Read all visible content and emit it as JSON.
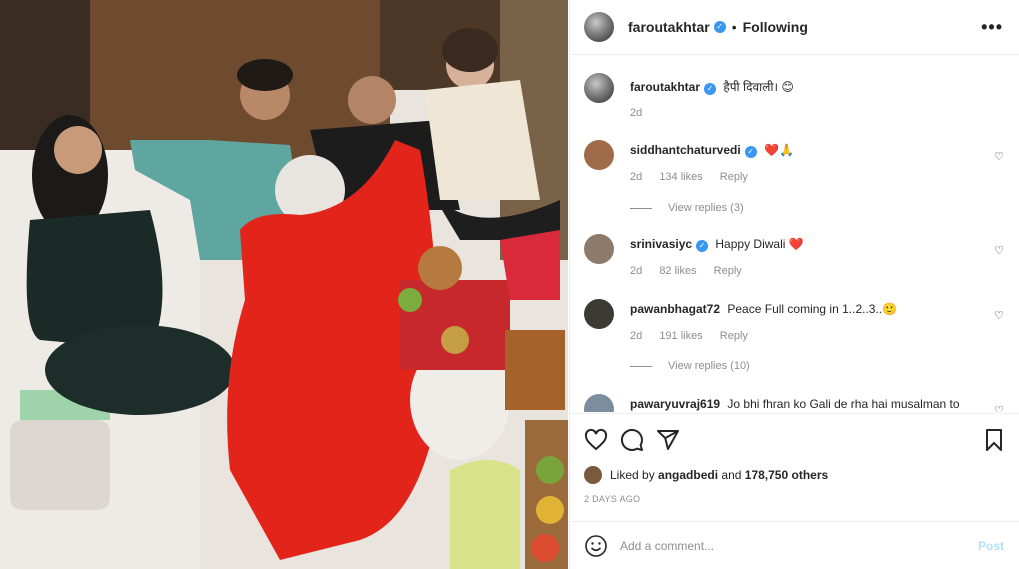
{
  "post": {
    "author": "faroutakhtar",
    "follow_state": "Following",
    "more_icon": "more-horizontal-icon",
    "caption": {
      "user": "faroutakhtar",
      "text": "हैपी दिवाली। 😊",
      "age": "2d"
    }
  },
  "comments": [
    {
      "user": "siddhantchaturvedi",
      "verified": true,
      "text": "❤️🙏",
      "age": "2d",
      "likes": "134 likes",
      "reply": "Reply",
      "avatar_color": "#a06b48"
    },
    {
      "user": "srinivasiyc",
      "verified": true,
      "text": "Happy Diwali ❤️",
      "age": "2d",
      "likes": "82 likes",
      "reply": "Reply",
      "avatar_color": "#8e7a6b"
    },
    {
      "user": "pawanbhagat72",
      "verified": false,
      "text": "Peace Full coming in 1..2..3..🙂",
      "age": "2d",
      "likes": "191 likes",
      "reply": "Reply",
      "avatar_color": "#3d3a36"
    },
    {
      "user": "pawaryuvraj619",
      "verified": false,
      "text": "Jo bhi fhran ko Gali de rha hai musalman to",
      "age": "",
      "likes": "",
      "reply": "",
      "avatar_color": "#7d8da0"
    }
  ],
  "view_replies": [
    "View replies (3)",
    "View replies (10)"
  ],
  "actions": {
    "like_icon": "heart-icon",
    "comment_icon": "comment-icon",
    "share_icon": "share-icon",
    "save_icon": "bookmark-icon"
  },
  "likes_line": {
    "prefix": "Liked by",
    "user": "angadbedi",
    "middle": "and",
    "count": "178,750 others"
  },
  "posted_ago": "2 DAYS AGO",
  "add_comment": {
    "placeholder": "Add a comment...",
    "post_label": "Post"
  },
  "colors": {
    "verified": "#3897f0",
    "heart_red": "#ed4956",
    "muted": "#8e8e8e",
    "post_button": "#b2dffc"
  }
}
